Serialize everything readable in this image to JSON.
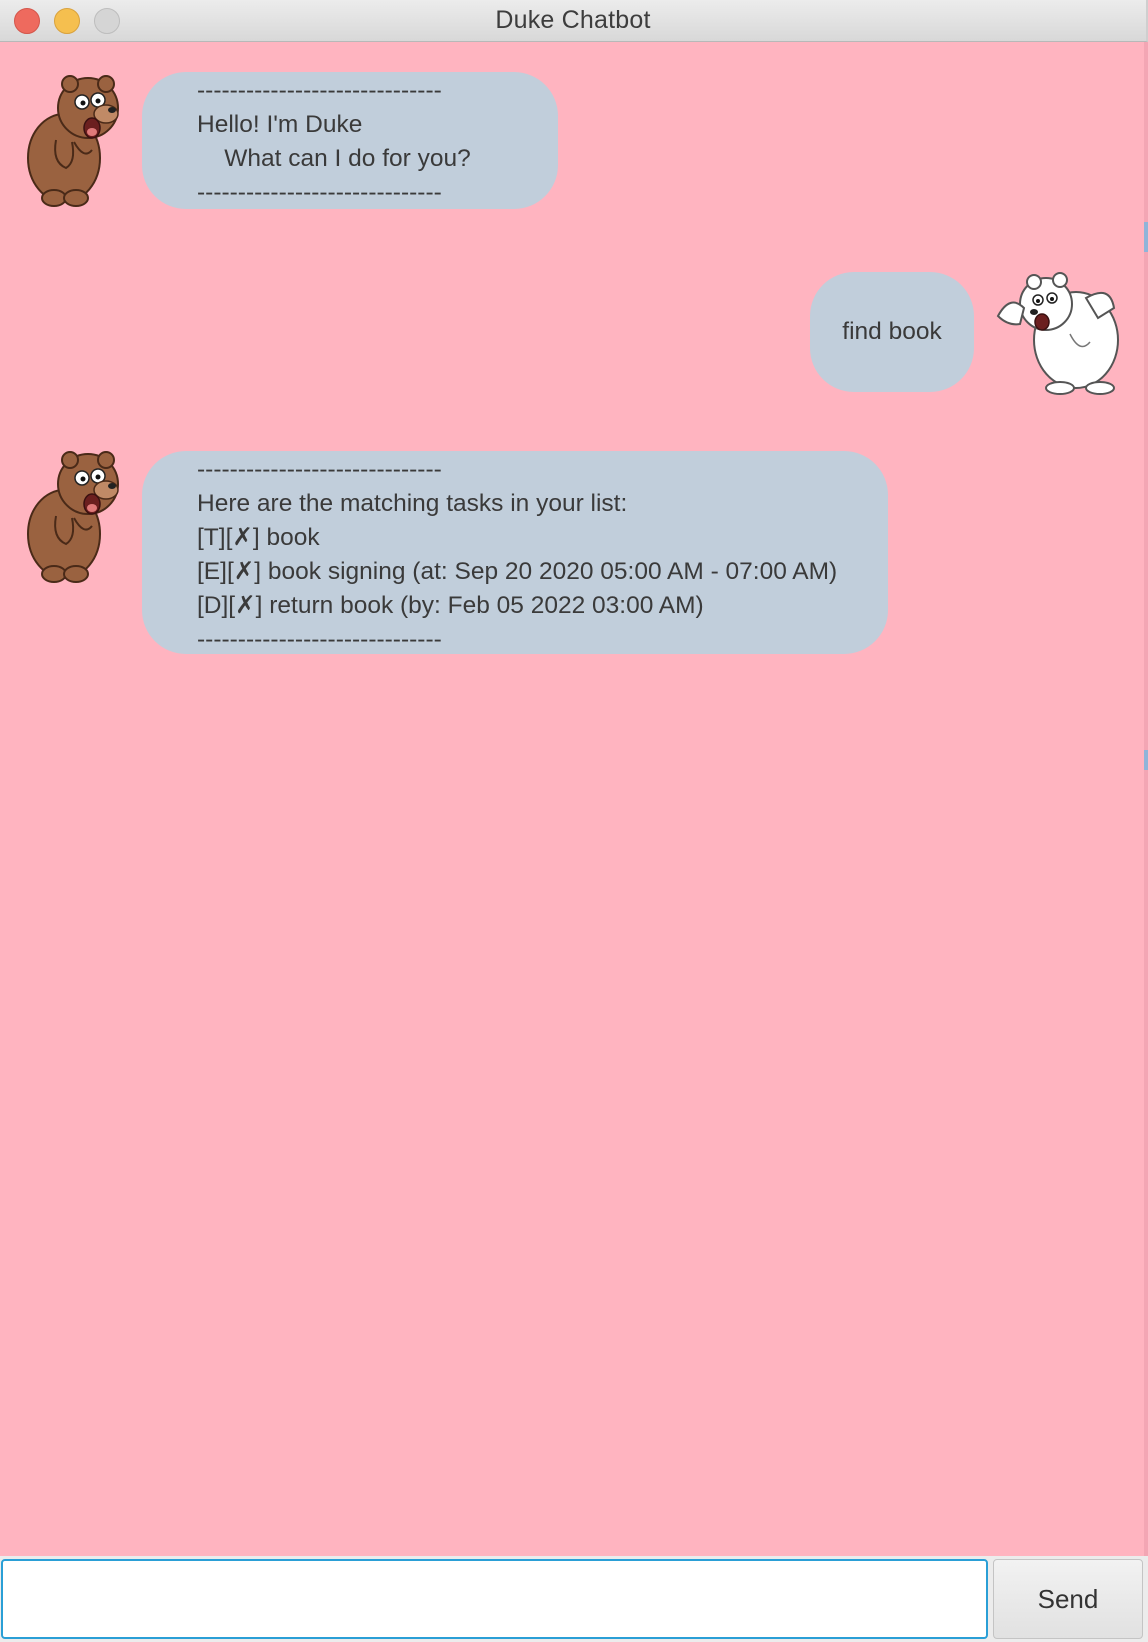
{
  "window": {
    "title": "Duke Chatbot"
  },
  "colors": {
    "chat_background": "#ffb4c0",
    "bubble": "#c1cedb",
    "input_focus": "#2a9fd6"
  },
  "messages": [
    {
      "sender": "duke",
      "avatar_icon": "brown-bear-icon",
      "lines": [
        "------------------------------",
        "Hello! I'm Duke",
        "    What can I do for you?",
        "------------------------------"
      ]
    },
    {
      "sender": "user",
      "avatar_icon": "polar-bear-icon",
      "lines": [
        "find book"
      ]
    },
    {
      "sender": "duke",
      "avatar_icon": "brown-bear-icon",
      "lines": [
        "------------------------------",
        "Here are the matching tasks in your list:",
        "[T][✗] book",
        "[E][✗] book signing (at: Sep 20 2020 05:00 AM - 07:00 AM)",
        "[D][✗] return book (by: Feb 05 2022 03:00 AM)",
        "------------------------------"
      ]
    }
  ],
  "input": {
    "value": "",
    "placeholder": ""
  },
  "send_button": {
    "label": "Send"
  }
}
